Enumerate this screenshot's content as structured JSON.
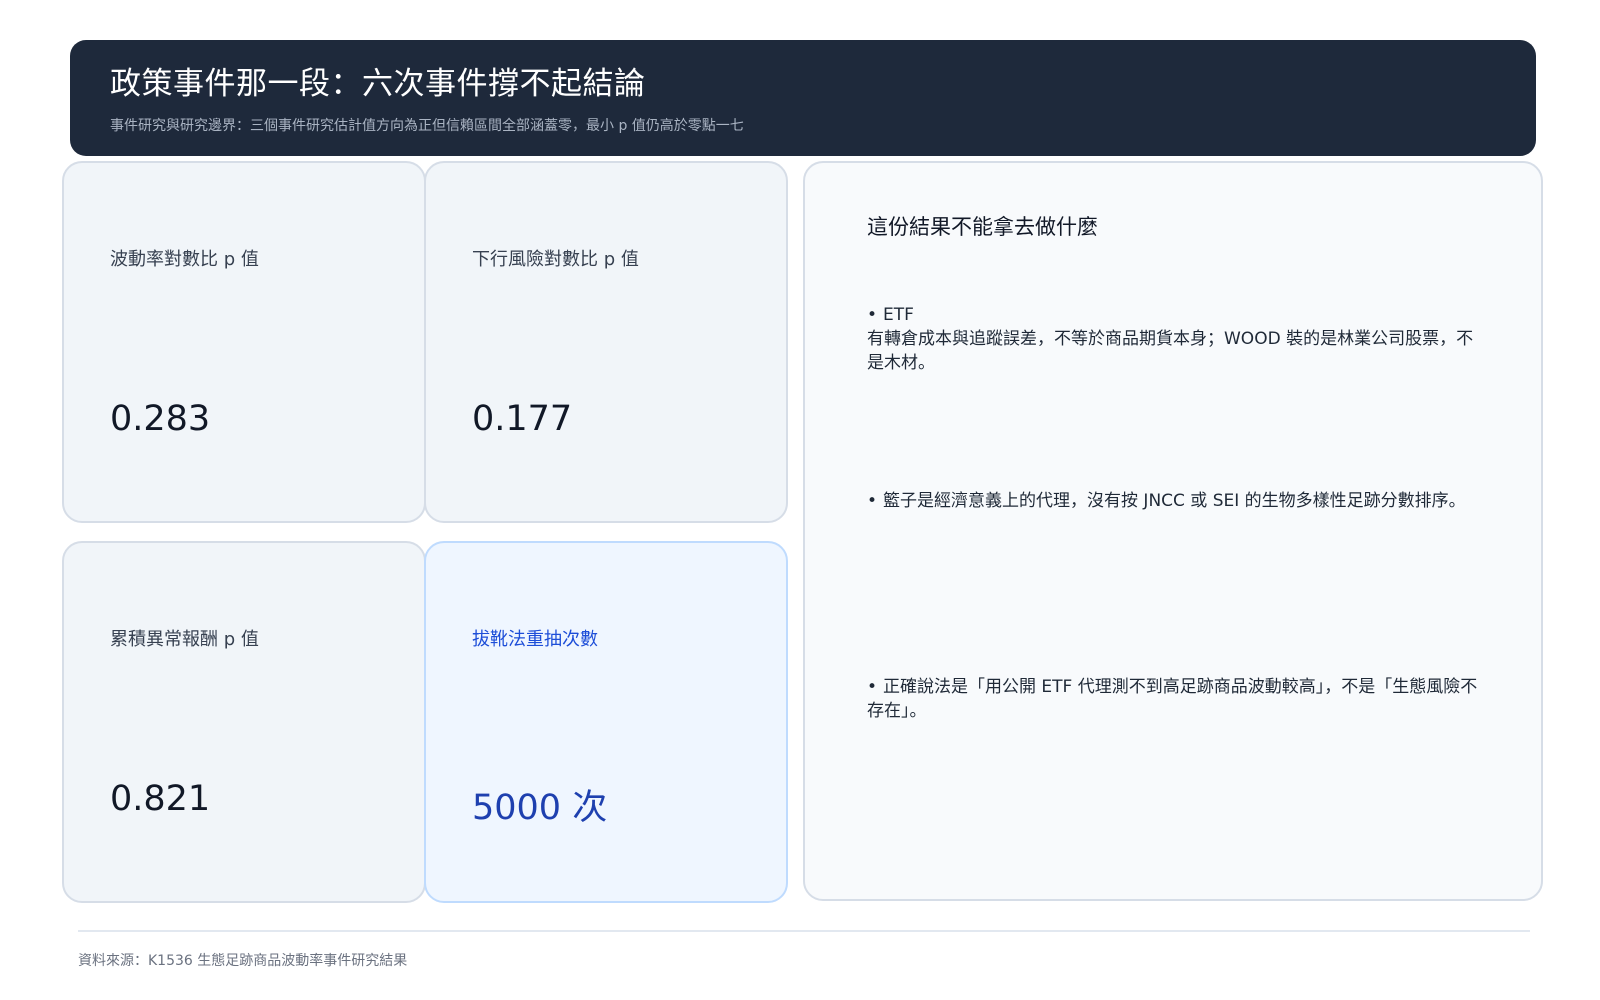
{
  "header": {
    "title": "政策事件那一段：六次事件撐不起結論",
    "subtitle": "事件研究與研究邊界：三個事件研究估計值方向為正但信賴區間全部涵蓋零，最小 p 值仍高於零點一七"
  },
  "stats": [
    {
      "label": "波動率對數比 p 值",
      "value": "0.283"
    },
    {
      "label": "下行風險對數比 p 值",
      "value": "0.177"
    },
    {
      "label": "累積異常報酬 p 值",
      "value": "0.821"
    },
    {
      "label": "拔靴法重抽次數",
      "value": "5000 次"
    }
  ],
  "panel": {
    "title": "這份結果不能拿去做什麼",
    "bullets": [
      {
        "lead": "ETF",
        "text": "有轉倉成本與追蹤誤差，不等於商品期貨本身；WOOD 裝的是林業公司股票，不是木材。"
      },
      {
        "lead": "",
        "text": "籃子是經濟意義上的代理，沒有按 JNCC 或 SEI 的生物多樣性足跡分數排序。"
      },
      {
        "lead": "",
        "text": "正確說法是「用公開 ETF 代理測不到高足跡商品波動較高」，不是「生態風險不存在」。"
      }
    ]
  },
  "footer": {
    "source": "資料來源：K1536 生態足跡商品波動率事件研究結果"
  },
  "colors": {
    "header_bg": "#1e293b",
    "card_bg": "#f1f5f9",
    "highlight_card_bg": "#eff6ff",
    "highlight_text": "#1e40af"
  }
}
